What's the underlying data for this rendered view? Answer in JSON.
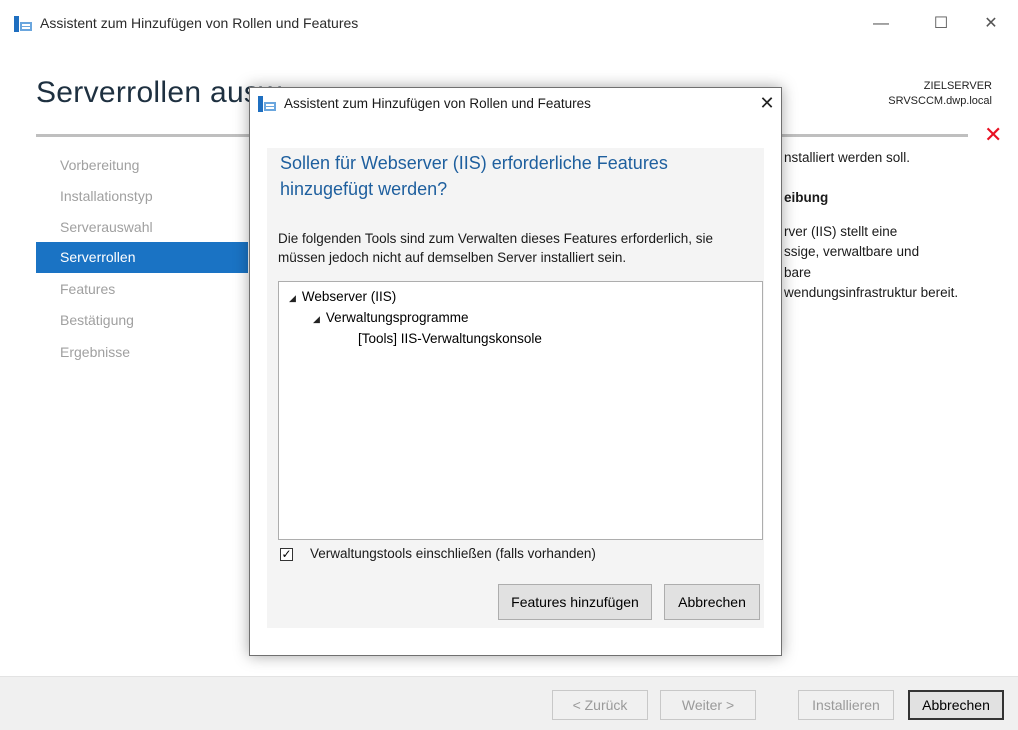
{
  "window": {
    "title": "Assistent zum Hinzufügen von Rollen und Features",
    "icon": "server-manager-icon",
    "controls": {
      "minimize": "—",
      "maximize": "☐",
      "close": "✕"
    }
  },
  "header": {
    "page_title": "Serverrollen ausw",
    "target_label": "ZIELSERVER",
    "target_name": "SRVSCCM.dwp.local",
    "error_icon": "✕",
    "error_color": "#e81123"
  },
  "sidebar": {
    "items": [
      {
        "label": "Vorbereitung",
        "active": false
      },
      {
        "label": "Installationstyp",
        "active": false
      },
      {
        "label": "Serverauswahl",
        "active": false
      },
      {
        "label": "Serverrollen",
        "active": true
      },
      {
        "label": "Features",
        "active": false
      },
      {
        "label": "Bestätigung",
        "active": false
      },
      {
        "label": "Ergebnisse",
        "active": false
      }
    ],
    "accent_color": "#1a73c4"
  },
  "background_content": {
    "line1": "nstalliert werden soll.",
    "heading": "eibung",
    "desc_lines": [
      "rver (IIS) stellt eine",
      "ssige, verwaltbare und",
      "bare",
      "wendungsinfrastruktur bereit."
    ]
  },
  "footer": {
    "back": "< Zurück",
    "next": "Weiter >",
    "install": "Installieren",
    "cancel": "Abbrechen"
  },
  "modal": {
    "title": "Assistent zum Hinzufügen von Rollen und Features",
    "close": "✕",
    "question": "Sollen für Webserver (IIS) erforderliche Features hinzugefügt werden?",
    "description": "Die folgenden Tools sind zum Verwalten dieses Features erforderlich, sie müssen jedoch nicht auf demselben Server installiert sein.",
    "tree": {
      "root": "Webserver (IIS)",
      "child": "Verwaltungsprogramme",
      "leaf": "[Tools] IIS-Verwaltungskonsole"
    },
    "include_tools_checked": true,
    "include_tools_label": "Verwaltungstools einschließen (falls vorhanden)",
    "add_features": "Features hinzufügen",
    "cancel": "Abbrechen",
    "question_color": "#1e5f9e"
  }
}
